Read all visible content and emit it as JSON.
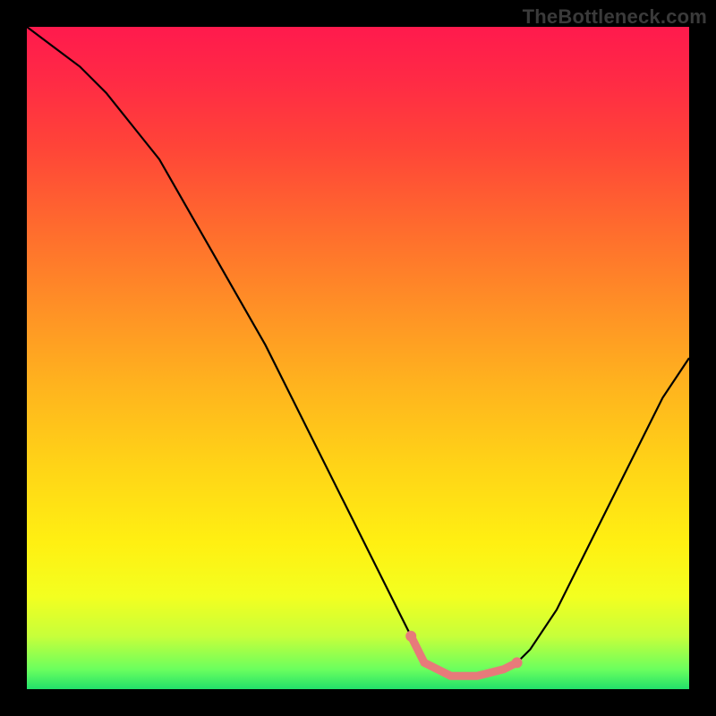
{
  "watermark": "TheBottleneck.com",
  "chart_data": {
    "type": "line",
    "title": "",
    "xlabel": "",
    "ylabel": "",
    "xlim": [
      0,
      100
    ],
    "ylim": [
      0,
      100
    ],
    "grid": false,
    "legend": false,
    "background_gradient": {
      "top": "#ff1a4d",
      "middle": "#ffd317",
      "bottom": "#22e06a"
    },
    "series": [
      {
        "name": "bottleneck-curve",
        "color": "#000000",
        "x": [
          0,
          4,
          8,
          12,
          16,
          20,
          24,
          28,
          32,
          36,
          40,
          44,
          48,
          52,
          56,
          58,
          60,
          64,
          68,
          72,
          74,
          76,
          80,
          84,
          88,
          92,
          96,
          100
        ],
        "values": [
          100,
          97,
          94,
          90,
          85,
          80,
          73,
          66,
          59,
          52,
          44,
          36,
          28,
          20,
          12,
          8,
          4,
          2,
          2,
          3,
          4,
          6,
          12,
          20,
          28,
          36,
          44,
          50
        ]
      }
    ],
    "highlight": {
      "name": "optimal-region",
      "color": "#e77a7a",
      "x_start": 58,
      "x_end": 74,
      "y": 2,
      "endpoint_markers": true
    }
  }
}
